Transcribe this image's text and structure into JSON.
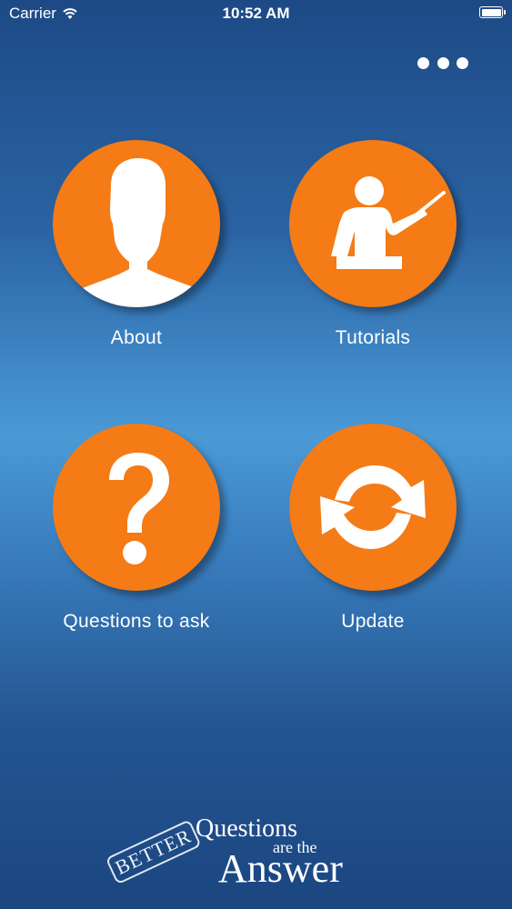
{
  "status_bar": {
    "carrier": "Carrier",
    "time": "10:52 AM"
  },
  "menu": {
    "more_icon": "ellipsis-icon"
  },
  "tiles": [
    {
      "label": "About",
      "icon": "person-silhouette-icon"
    },
    {
      "label": "Tutorials",
      "icon": "teacher-pointer-icon"
    },
    {
      "label": "Questions to ask",
      "icon": "question-mark-icon"
    },
    {
      "label": "Update",
      "icon": "refresh-icon"
    }
  ],
  "logo": {
    "word1": "BETTER",
    "word2": "Questions",
    "word3": "are the",
    "word4": "Answer"
  },
  "colors": {
    "accent": "#f47b16",
    "background_top": "#1d4a85",
    "background_mid": "#4a9ad6"
  }
}
